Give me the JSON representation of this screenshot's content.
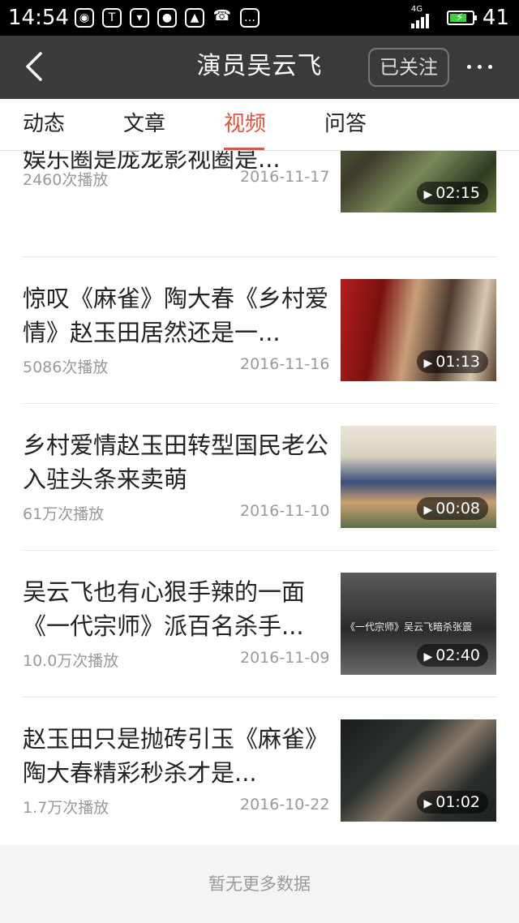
{
  "status_bar": {
    "time": "14:54",
    "network": "4G",
    "battery_level": "41",
    "notification_icons": [
      "weibo-icon",
      "toutiao-icon",
      "shield-icon",
      "location-icon",
      "image-icon",
      "missed-call-icon",
      "message-icon"
    ]
  },
  "header": {
    "title": "演员吴云飞",
    "follow_label": "已关注"
  },
  "tabs": [
    {
      "label": "动态"
    },
    {
      "label": "文章"
    },
    {
      "label": "视频"
    },
    {
      "label": "问答"
    }
  ],
  "active_tab": "视频",
  "videos": [
    {
      "title": "可以把玫瑰花唱成大老爷们的娱乐圈是庞龙影视圈是...",
      "plays": "2460次播放",
      "date": "2016-11-17",
      "duration": "02:15"
    },
    {
      "title": "惊叹《麻雀》陶大春《乡村爱情》赵玉田居然还是一...",
      "plays": "5086次播放",
      "date": "2016-11-16",
      "duration": "01:13"
    },
    {
      "title": "乡村爱情赵玉田转型国民老公 入驻头条来卖萌",
      "plays": "61万次播放",
      "date": "2016-11-10",
      "duration": "00:08"
    },
    {
      "title": "吴云飞也有心狠手辣的一面《一代宗师》派百名杀手...",
      "plays": "10.0万次播放",
      "date": "2016-11-09",
      "duration": "02:40",
      "thumb_caption": "《一代宗师》吴云飞暗杀张震"
    },
    {
      "title": "赵玉田只是抛砖引玉《麻雀》陶大春精彩秒杀才是...",
      "plays": "1.7万次播放",
      "date": "2016-10-22",
      "duration": "01:02"
    }
  ],
  "footer": {
    "text": "暂无更多数据"
  },
  "colors": {
    "accent": "#e0543e",
    "navbar": "#3a3a3a",
    "battery": "#3ecf3e"
  }
}
